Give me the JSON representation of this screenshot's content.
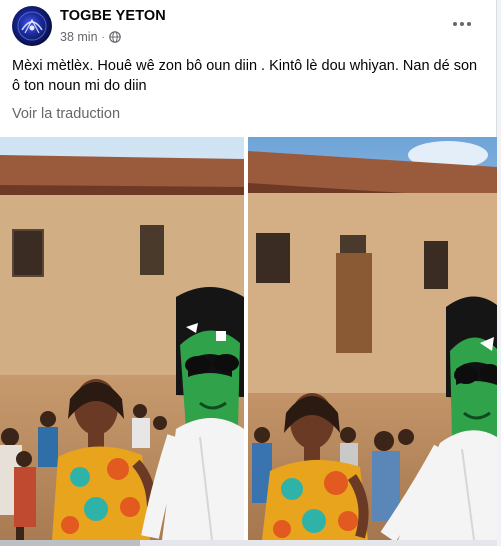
{
  "post": {
    "author": "TOGBE YETON",
    "time": "38 min",
    "separator": "·",
    "audience_icon": "globe-icon",
    "more_icon": "more-horizontal-icon",
    "text": "Mèxi mètlèx. Houê wê zon bô oun diin . Kintô lè dou whiyan. Nan dé son ô ton noun mi do diin",
    "translate_label": "Voir la traduction"
  },
  "photos": [
    {
      "name": "photo-left"
    },
    {
      "name": "photo-right"
    }
  ],
  "colors": {
    "text_primary": "#050505",
    "text_secondary": "#65676b",
    "card_bg": "#ffffff",
    "page_bg": "#f0f2f5"
  }
}
